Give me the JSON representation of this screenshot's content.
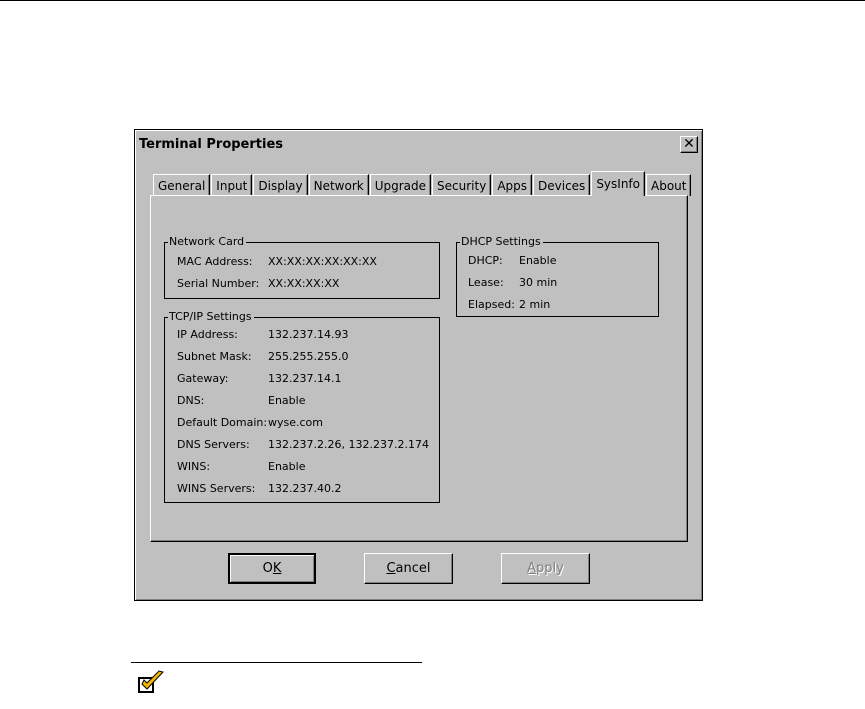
{
  "window": {
    "title": "Terminal Properties"
  },
  "tabs": [
    "General",
    "Input",
    "Display",
    "Network",
    "Upgrade",
    "Security",
    "Apps",
    "Devices",
    "SysInfo",
    "About"
  ],
  "active_tab": "SysInfo",
  "network_card": {
    "legend": "Network Card",
    "rows": [
      {
        "label": "MAC Address:",
        "value": "XX:XX:XX:XX:XX:XX"
      },
      {
        "label": "Serial Number:",
        "value": "XX:XX:XX:XX"
      }
    ]
  },
  "tcpip": {
    "legend": "TCP/IP Settings",
    "rows": [
      {
        "label": "IP Address:",
        "value": "132.237.14.93"
      },
      {
        "label": "Subnet Mask:",
        "value": "255.255.255.0"
      },
      {
        "label": "Gateway:",
        "value": "132.237.14.1"
      },
      {
        "label": "DNS:",
        "value": "Enable"
      },
      {
        "label": "Default Domain:",
        "value": "wyse.com"
      },
      {
        "label": "DNS Servers:",
        "value": "132.237.2.26, 132.237.2.174"
      },
      {
        "label": "WINS:",
        "value": "Enable"
      },
      {
        "label": "WINS Servers:",
        "value": "132.237.40.2"
      }
    ]
  },
  "dhcp": {
    "legend": "DHCP Settings",
    "rows": [
      {
        "label": "DHCP:",
        "value": "Enable"
      },
      {
        "label": "Lease:",
        "value": "30 min"
      },
      {
        "label": "Elapsed:",
        "value": "2 min"
      }
    ]
  },
  "buttons": {
    "ok": {
      "pre": "O",
      "mnemonic": "K",
      "post": ""
    },
    "cancel": {
      "pre": "",
      "mnemonic": "C",
      "post": "ancel"
    },
    "apply": {
      "pre": "",
      "mnemonic": "A",
      "post": "pply"
    }
  },
  "icons": {
    "close": "close-icon",
    "note": "checkmark-icon"
  },
  "colors": {
    "dialog_bg": "#c0c0c0",
    "check_fill": "#f2b705"
  }
}
